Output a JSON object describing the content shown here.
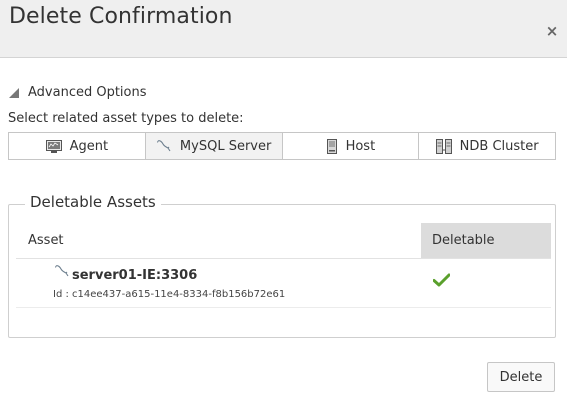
{
  "dialog": {
    "title": "Delete Confirmation",
    "close_symbol": "×"
  },
  "advanced": {
    "label": "Advanced Options",
    "select_label": "Select related asset types to delete:",
    "types": [
      {
        "label": "Agent",
        "icon": "agent-icon"
      },
      {
        "label": "MySQL Server",
        "icon": "mysql-dolphin-icon"
      },
      {
        "label": "Host",
        "icon": "host-server-icon"
      },
      {
        "label": "NDB Cluster",
        "icon": "ndb-cluster-icon"
      }
    ]
  },
  "assets": {
    "legend": "Deletable Assets",
    "columns": {
      "asset": "Asset",
      "deletable": "Deletable"
    },
    "rows": [
      {
        "name": "server01-IE:3306",
        "id": "Id : c14ee437-a615-11e4-8334-f8b156b72e61",
        "deletable": true
      }
    ]
  },
  "footer": {
    "delete_label": "Delete"
  },
  "colors": {
    "check": "#5aa02c",
    "header_bg": "#efefef",
    "deletable_col_bg": "#dcdcdc"
  }
}
